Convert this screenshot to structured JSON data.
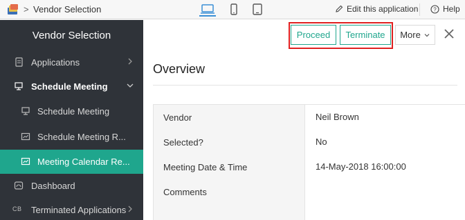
{
  "topbar": {
    "app_title": "Vendor Selection",
    "breadcrumb_separator": ">",
    "edit_label": "Edit this application",
    "help_label": "Help",
    "devices": [
      "laptop-icon",
      "mobile-icon",
      "tablet-icon"
    ],
    "active_device": "laptop-icon"
  },
  "sidebar": {
    "title": "Vendor Selection",
    "items": [
      {
        "label": "Applications",
        "icon": "document-icon",
        "chevron": "right"
      },
      {
        "label": "Schedule Meeting",
        "icon": "presentation-icon",
        "chevron": "down",
        "expanded": true
      },
      {
        "label": "Schedule Meeting",
        "icon": "presentation-icon",
        "sub": true
      },
      {
        "label": "Schedule Meeting R...",
        "icon": "report-icon",
        "sub": true
      },
      {
        "label": "Meeting Calendar Re...",
        "icon": "report-icon",
        "sub": true,
        "active": true
      },
      {
        "label": "Dashboard",
        "icon": "dashboard-icon"
      },
      {
        "label": "Terminated Applications",
        "icon_text": "CB",
        "chevron": "right"
      }
    ]
  },
  "toolbar": {
    "proceed_label": "Proceed",
    "terminate_label": "Terminate",
    "more_label": "More"
  },
  "record": {
    "section_title": "Overview",
    "fields": [
      {
        "label": "Vendor",
        "value": "Neil Brown"
      },
      {
        "label": "Selected?",
        "value": "No"
      },
      {
        "label": "Meeting Date & Time",
        "value": "14-May-2018 16:00:00"
      },
      {
        "label": "Comments",
        "value": ""
      }
    ]
  },
  "colors": {
    "accent": "#1fa68d",
    "sidebar_bg": "#2f3339",
    "highlight": "#e02020"
  }
}
